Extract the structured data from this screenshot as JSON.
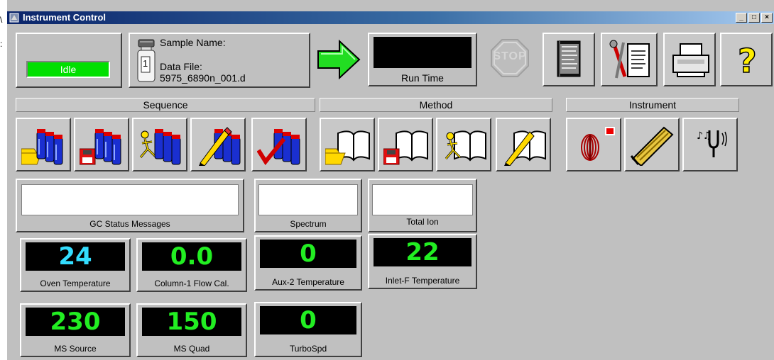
{
  "window": {
    "title": "Instrument Control",
    "controls": [
      "_",
      "□",
      "×"
    ]
  },
  "status": {
    "text": "Idle",
    "color": "#00e000"
  },
  "sample": {
    "name_label": "Sample Name:",
    "datafile_label": "Data File:",
    "datafile_value": "5975_6890n_001.d",
    "vial_number": "1"
  },
  "run": {
    "runtime_label": "Run Time",
    "stop_label": "STOP"
  },
  "sections": {
    "sequence": "Sequence",
    "method": "Method",
    "instrument": "Instrument"
  },
  "panels": {
    "gc_status": "GC Status Messages",
    "spectrum": "Spectrum",
    "total_ion": "Total Ion"
  },
  "readings": [
    {
      "label": "Oven Temperature",
      "value": "24",
      "color": "#33ddff"
    },
    {
      "label": "Column-1 Flow Cal.",
      "value": "0.0",
      "color": "#22ee22"
    },
    {
      "label": "Aux-2 Temperature",
      "value": "0",
      "color": "#22ee22"
    },
    {
      "label": "Inlet-F Temperature",
      "value": "22",
      "color": "#22ee22"
    },
    {
      "label": "MS Source",
      "value": "230",
      "color": "#22ee22"
    },
    {
      "label": "MS Quad",
      "value": "150",
      "color": "#22ee22"
    },
    {
      "label": "TurboSpd",
      "value": "0",
      "color": "#22ee22"
    }
  ]
}
